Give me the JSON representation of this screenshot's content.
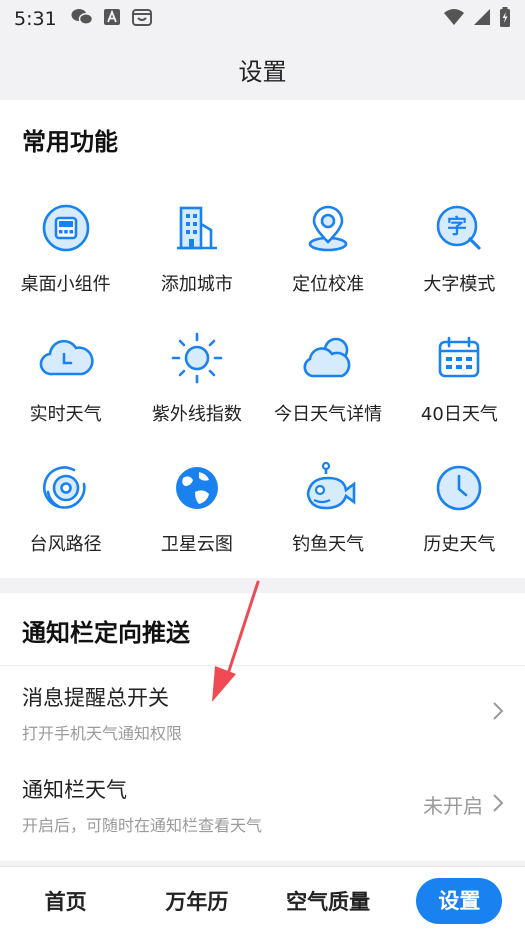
{
  "status_bar": {
    "time": "5:31",
    "left_icons": [
      "wechat-icon",
      "a-badge-icon",
      "cart-app-icon"
    ],
    "right_icons": [
      "wifi-icon",
      "signal-icon",
      "battery-charging-icon"
    ]
  },
  "page": {
    "title": "设置"
  },
  "common": {
    "title": "常用功能",
    "items": [
      {
        "label": "桌面小组件",
        "icon": "widget-icon"
      },
      {
        "label": "添加城市",
        "icon": "city-building-icon"
      },
      {
        "label": "定位校准",
        "icon": "location-pin-icon"
      },
      {
        "label": "大字模式",
        "icon": "big-font-icon"
      },
      {
        "label": "实时天气",
        "icon": "cloud-clock-icon"
      },
      {
        "label": "紫外线指数",
        "icon": "sun-icon"
      },
      {
        "label": "今日天气详情",
        "icon": "sun-cloud-icon"
      },
      {
        "label": "40日天气",
        "icon": "calendar-icon"
      },
      {
        "label": "台风路径",
        "icon": "typhoon-icon"
      },
      {
        "label": "卫星云图",
        "icon": "globe-icon"
      },
      {
        "label": "钓鱼天气",
        "icon": "fish-icon"
      },
      {
        "label": "历史天气",
        "icon": "clock-icon"
      }
    ]
  },
  "notify": {
    "title": "通知栏定向推送",
    "rows": [
      {
        "title": "消息提醒总开关",
        "subtitle": "打开手机天气通知权限",
        "value": ""
      },
      {
        "title": "通知栏天气",
        "subtitle": "开启后，可随时在通知栏查看天气",
        "value": "未开启"
      }
    ]
  },
  "bottom_nav": {
    "tabs": [
      {
        "label": "首页"
      },
      {
        "label": "万年历"
      },
      {
        "label": "空气质量"
      },
      {
        "label": "设置",
        "active": true
      }
    ]
  },
  "colors": {
    "accent": "#1a82f0",
    "icon_fill": "#d7ebff",
    "annotation": "#f04a55"
  }
}
